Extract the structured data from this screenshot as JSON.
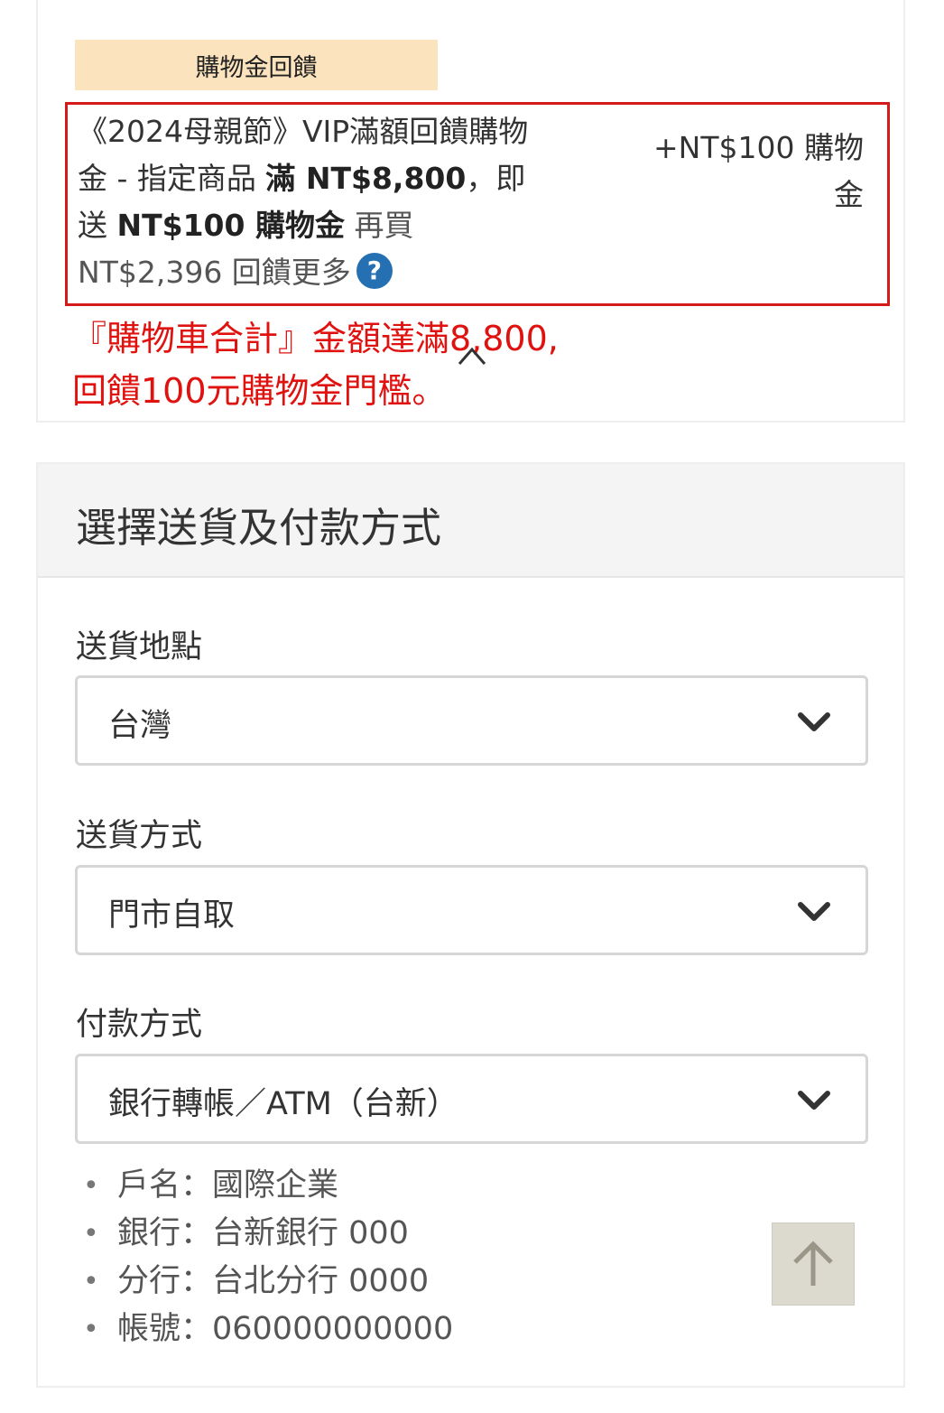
{
  "rewards": {
    "badge": "購物金回饋",
    "promo": {
      "line1": "《2024母親節》VIP滿額回饋購物",
      "line2_prefix": "金 - 指定商品 ",
      "threshold_bold": "滿 NT$8,800",
      "line2_suffix": "，即",
      "line3_prefix": "送 ",
      "gift_bold": "NT$100 購物金",
      "more_label": " 再買",
      "remaining": "NT$2,396 回饋更多",
      "reward": "+NT$100 購物金"
    },
    "annotation_line1": "『購物車合計』金額達滿8,800,",
    "annotation_line2": "回饋100元購物金門檻。"
  },
  "shipping": {
    "title": "選擇送貨及付款方式",
    "location_label": "送貨地點",
    "location_value": "台灣",
    "method_label": "送貨方式",
    "method_value": "門市自取",
    "payment_label": "付款方式",
    "payment_value": "銀行轉帳／ATM（台新）",
    "bank_details": [
      "戶名：國際企業",
      "銀行：台新銀行 000",
      "分行：台北分行 0000",
      "帳號：060000000000"
    ]
  },
  "icons": {
    "help": "?",
    "help_color": "#2470b3",
    "annotation_color": "#e0120f",
    "highlight_color": "#d61a1a"
  }
}
